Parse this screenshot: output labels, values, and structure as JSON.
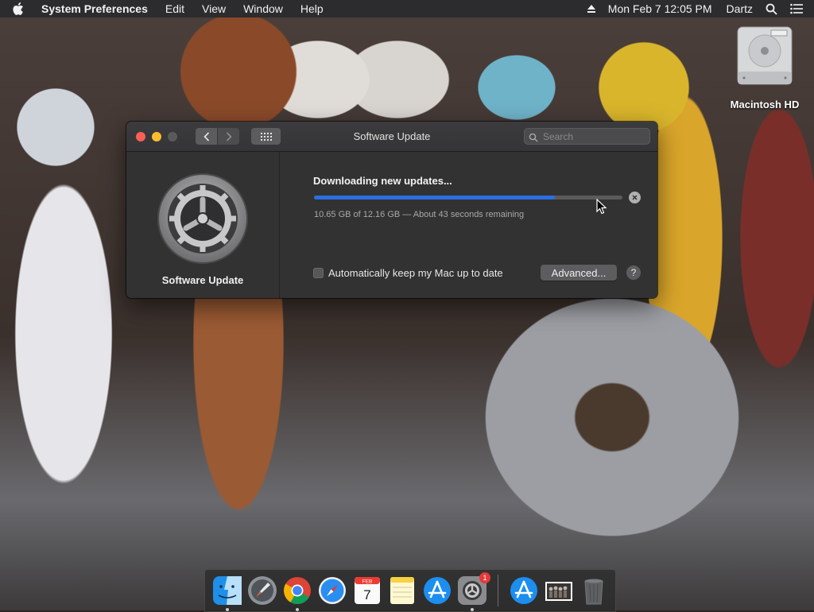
{
  "menubar": {
    "apple_icon": "apple-logo",
    "app_name": "System Preferences",
    "items": [
      "Edit",
      "View",
      "Window",
      "Help"
    ],
    "clock": "Mon Feb 7  12:05 PM",
    "user": "Dartz",
    "status_icons": [
      "eject-icon",
      "spotlight-search-icon",
      "notification-center-icon"
    ]
  },
  "desktop": {
    "drive_label": "Macintosh HD"
  },
  "window": {
    "title": "Software Update",
    "search_placeholder": "Search",
    "sidebar_title": "Software Update",
    "status_title": "Downloading new updates...",
    "progress_fraction": 0.78,
    "progress_detail": "10.65 GB of 12.16 GB — About 43 seconds remaining",
    "auto_update_label": "Automatically keep my Mac up to date",
    "auto_update_checked": false,
    "advanced_button": "Advanced...",
    "help_button": "?",
    "accent_color": "#2a6ee0"
  },
  "dock": {
    "apps": [
      "Finder",
      "Launchpad",
      "Google Chrome",
      "Safari",
      "Calendar",
      "Notes",
      "App Store",
      "System Preferences",
      "App Store Downloads",
      "Photos Stack",
      "Trash"
    ],
    "calendar_month": "FEB",
    "calendar_day": "7",
    "system_prefs_badge": "1"
  }
}
